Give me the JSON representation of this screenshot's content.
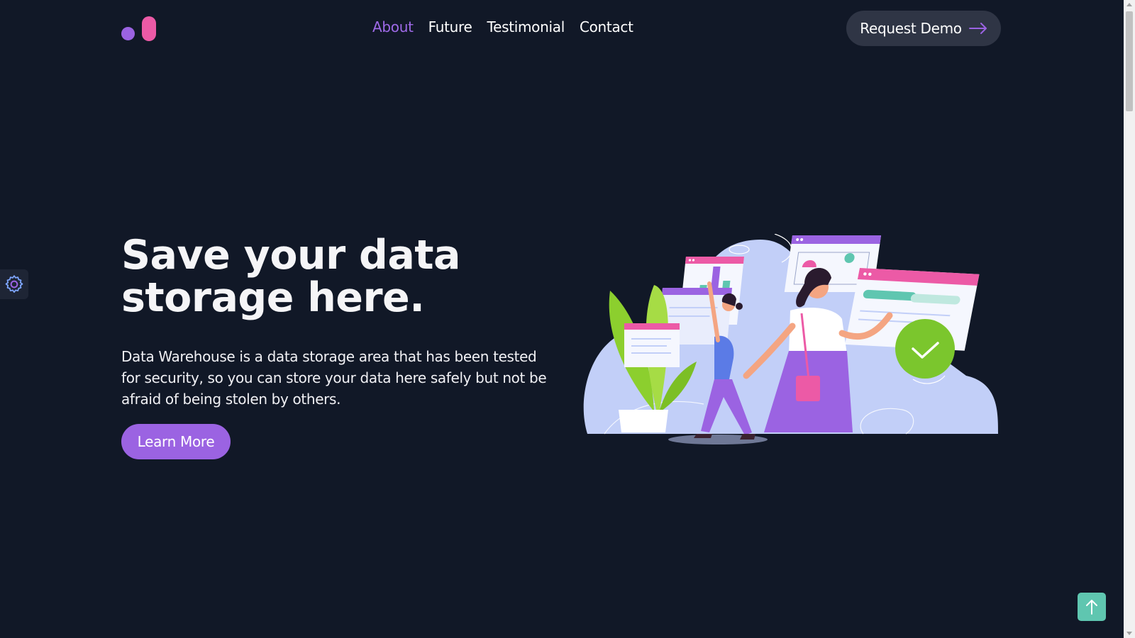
{
  "brand": {
    "logo_colors": {
      "dot": "#9b63e2",
      "pill": "#ec5aa6"
    }
  },
  "nav": {
    "items": [
      {
        "label": "About",
        "active": true
      },
      {
        "label": "Future",
        "active": false
      },
      {
        "label": "Testimonial",
        "active": false
      },
      {
        "label": "Contact",
        "active": false
      }
    ],
    "active_color": "#9f6ae8"
  },
  "header": {
    "demo_button_label": "Request Demo",
    "demo_button_icon": "arrow-right-icon"
  },
  "hero": {
    "title_line1": "Save your data",
    "title_line2": "storage here.",
    "description": "Data Warehouse is a data storage area that has been tested for security, so you can store your data here safely but not be afraid of being stolen by others.",
    "cta_label": "Learn More",
    "illustration": "woman-with-data-screens-illustration"
  },
  "side": {
    "settings_icon": "gear-icon"
  },
  "floating": {
    "scroll_top_icon": "arrow-up-icon",
    "color": "#5fc6b0"
  },
  "colors": {
    "background": "#111827",
    "accent": "#9b63e2",
    "button_dark": "#2f3545"
  }
}
